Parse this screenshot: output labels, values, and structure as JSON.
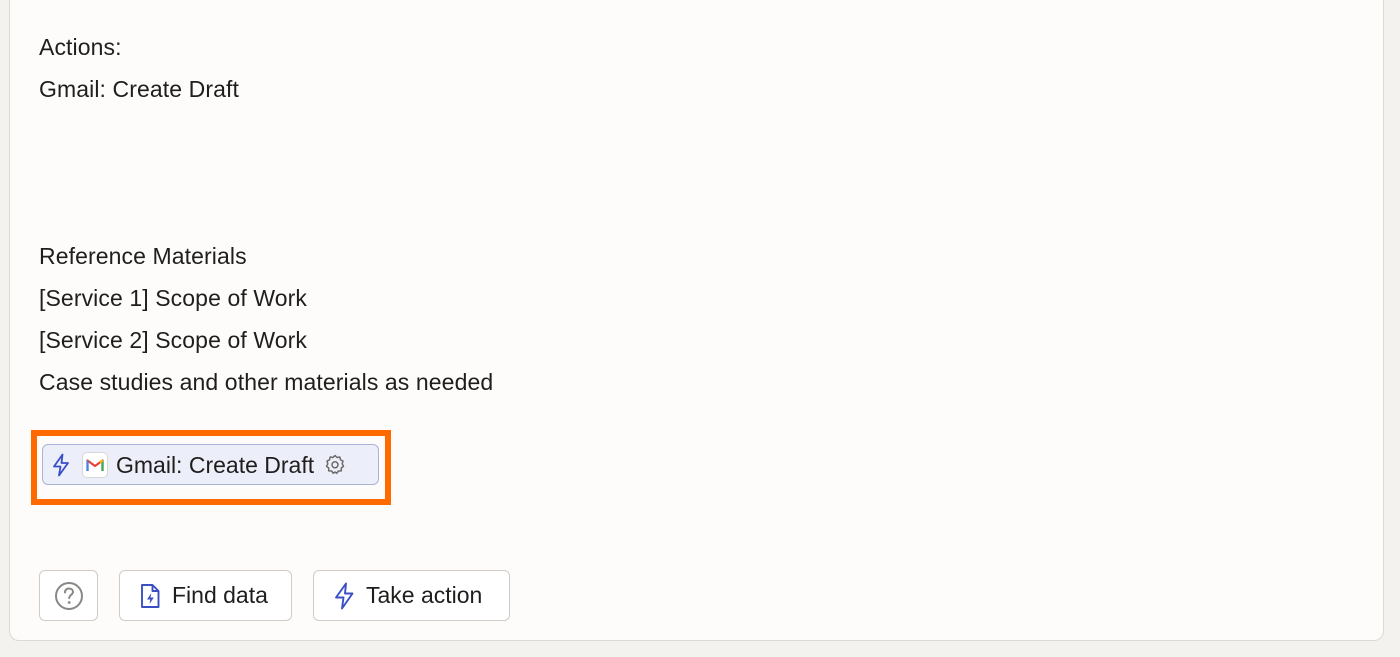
{
  "content": {
    "lines": [
      "Actions:",
      "Gmail: Create Draft",
      "Reference Materials",
      "[Service 1] Scope of Work",
      "[Service 2] Scope of Work",
      "Case studies and other materials as needed"
    ]
  },
  "chip": {
    "label": "Gmail: Create Draft",
    "icons": [
      "lightning-bolt-icon",
      "gmail-logo",
      "gear-icon"
    ]
  },
  "highlight_color": "#ff6a00",
  "toolbar": {
    "help_icon": "question-circle-icon",
    "find_data_label": "Find data",
    "find_data_icon": "file-lightning-icon",
    "take_action_label": "Take action",
    "take_action_icon": "lightning-bolt-icon"
  },
  "colors": {
    "accent": "#3b4fc4",
    "chip_background": "#eceefa",
    "chip_border": "#aab3d6"
  }
}
